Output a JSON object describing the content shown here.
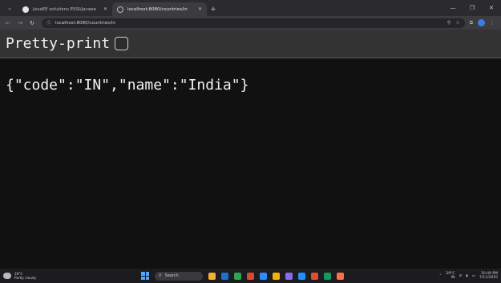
{
  "browser": {
    "tabs": [
      {
        "title": "JavaEE solutions ESSI/javaee",
        "icon": "github-icon",
        "active": false
      },
      {
        "title": "localhost:8080/countries/in",
        "icon": "globe-icon",
        "active": true
      }
    ],
    "address": {
      "url": "localhost:8080/countries/in"
    }
  },
  "page": {
    "pretty_print_label": "Pretty-print",
    "pretty_print_checked": false,
    "json_text": "{\"code\":\"IN\",\"name\":\"India\"}"
  },
  "taskbar": {
    "weather_temp": "28°C",
    "weather_desc": "Partly cloudy",
    "search_placeholder": "Search",
    "tray_temp": "29°C",
    "tray_locale": "IN",
    "time": "10:49 PM",
    "date": "7/11/2025",
    "app_icon_colors": [
      "#f2b22c",
      "#1f6fd1",
      "#2da44e",
      "#e2472b",
      "#2f8cff",
      "#f4b400",
      "#8a6be8",
      "#1e90ff",
      "#e44d26",
      "#0f9d58",
      "#ff7043"
    ]
  }
}
